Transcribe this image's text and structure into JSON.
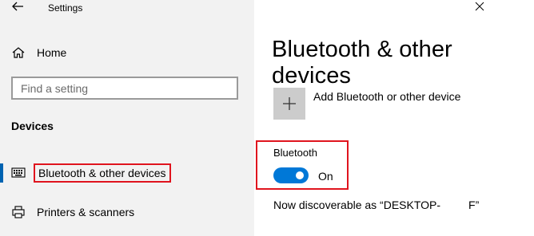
{
  "window": {
    "title": "Settings"
  },
  "nav": {
    "home_label": "Home",
    "search_placeholder": "Find a setting",
    "section_heading": "Devices",
    "items": [
      {
        "label": "Bluetooth & other devices",
        "icon": "keyboard-icon",
        "active": true
      },
      {
        "label": "Printers & scanners",
        "icon": "printer-icon",
        "active": false
      }
    ]
  },
  "main": {
    "title": "Bluetooth & other devices",
    "add_device_label": "Add Bluetooth or other device",
    "bluetooth": {
      "heading": "Bluetooth",
      "state_label": "On",
      "enabled": true
    },
    "discoverable_text": "Now discoverable as “DESKTOP-         F”"
  },
  "colors": {
    "accent": "#0078d7",
    "highlight_box": "#e0141e",
    "nav_bg": "#f2f2f2",
    "tile_bg": "#cccccc"
  }
}
